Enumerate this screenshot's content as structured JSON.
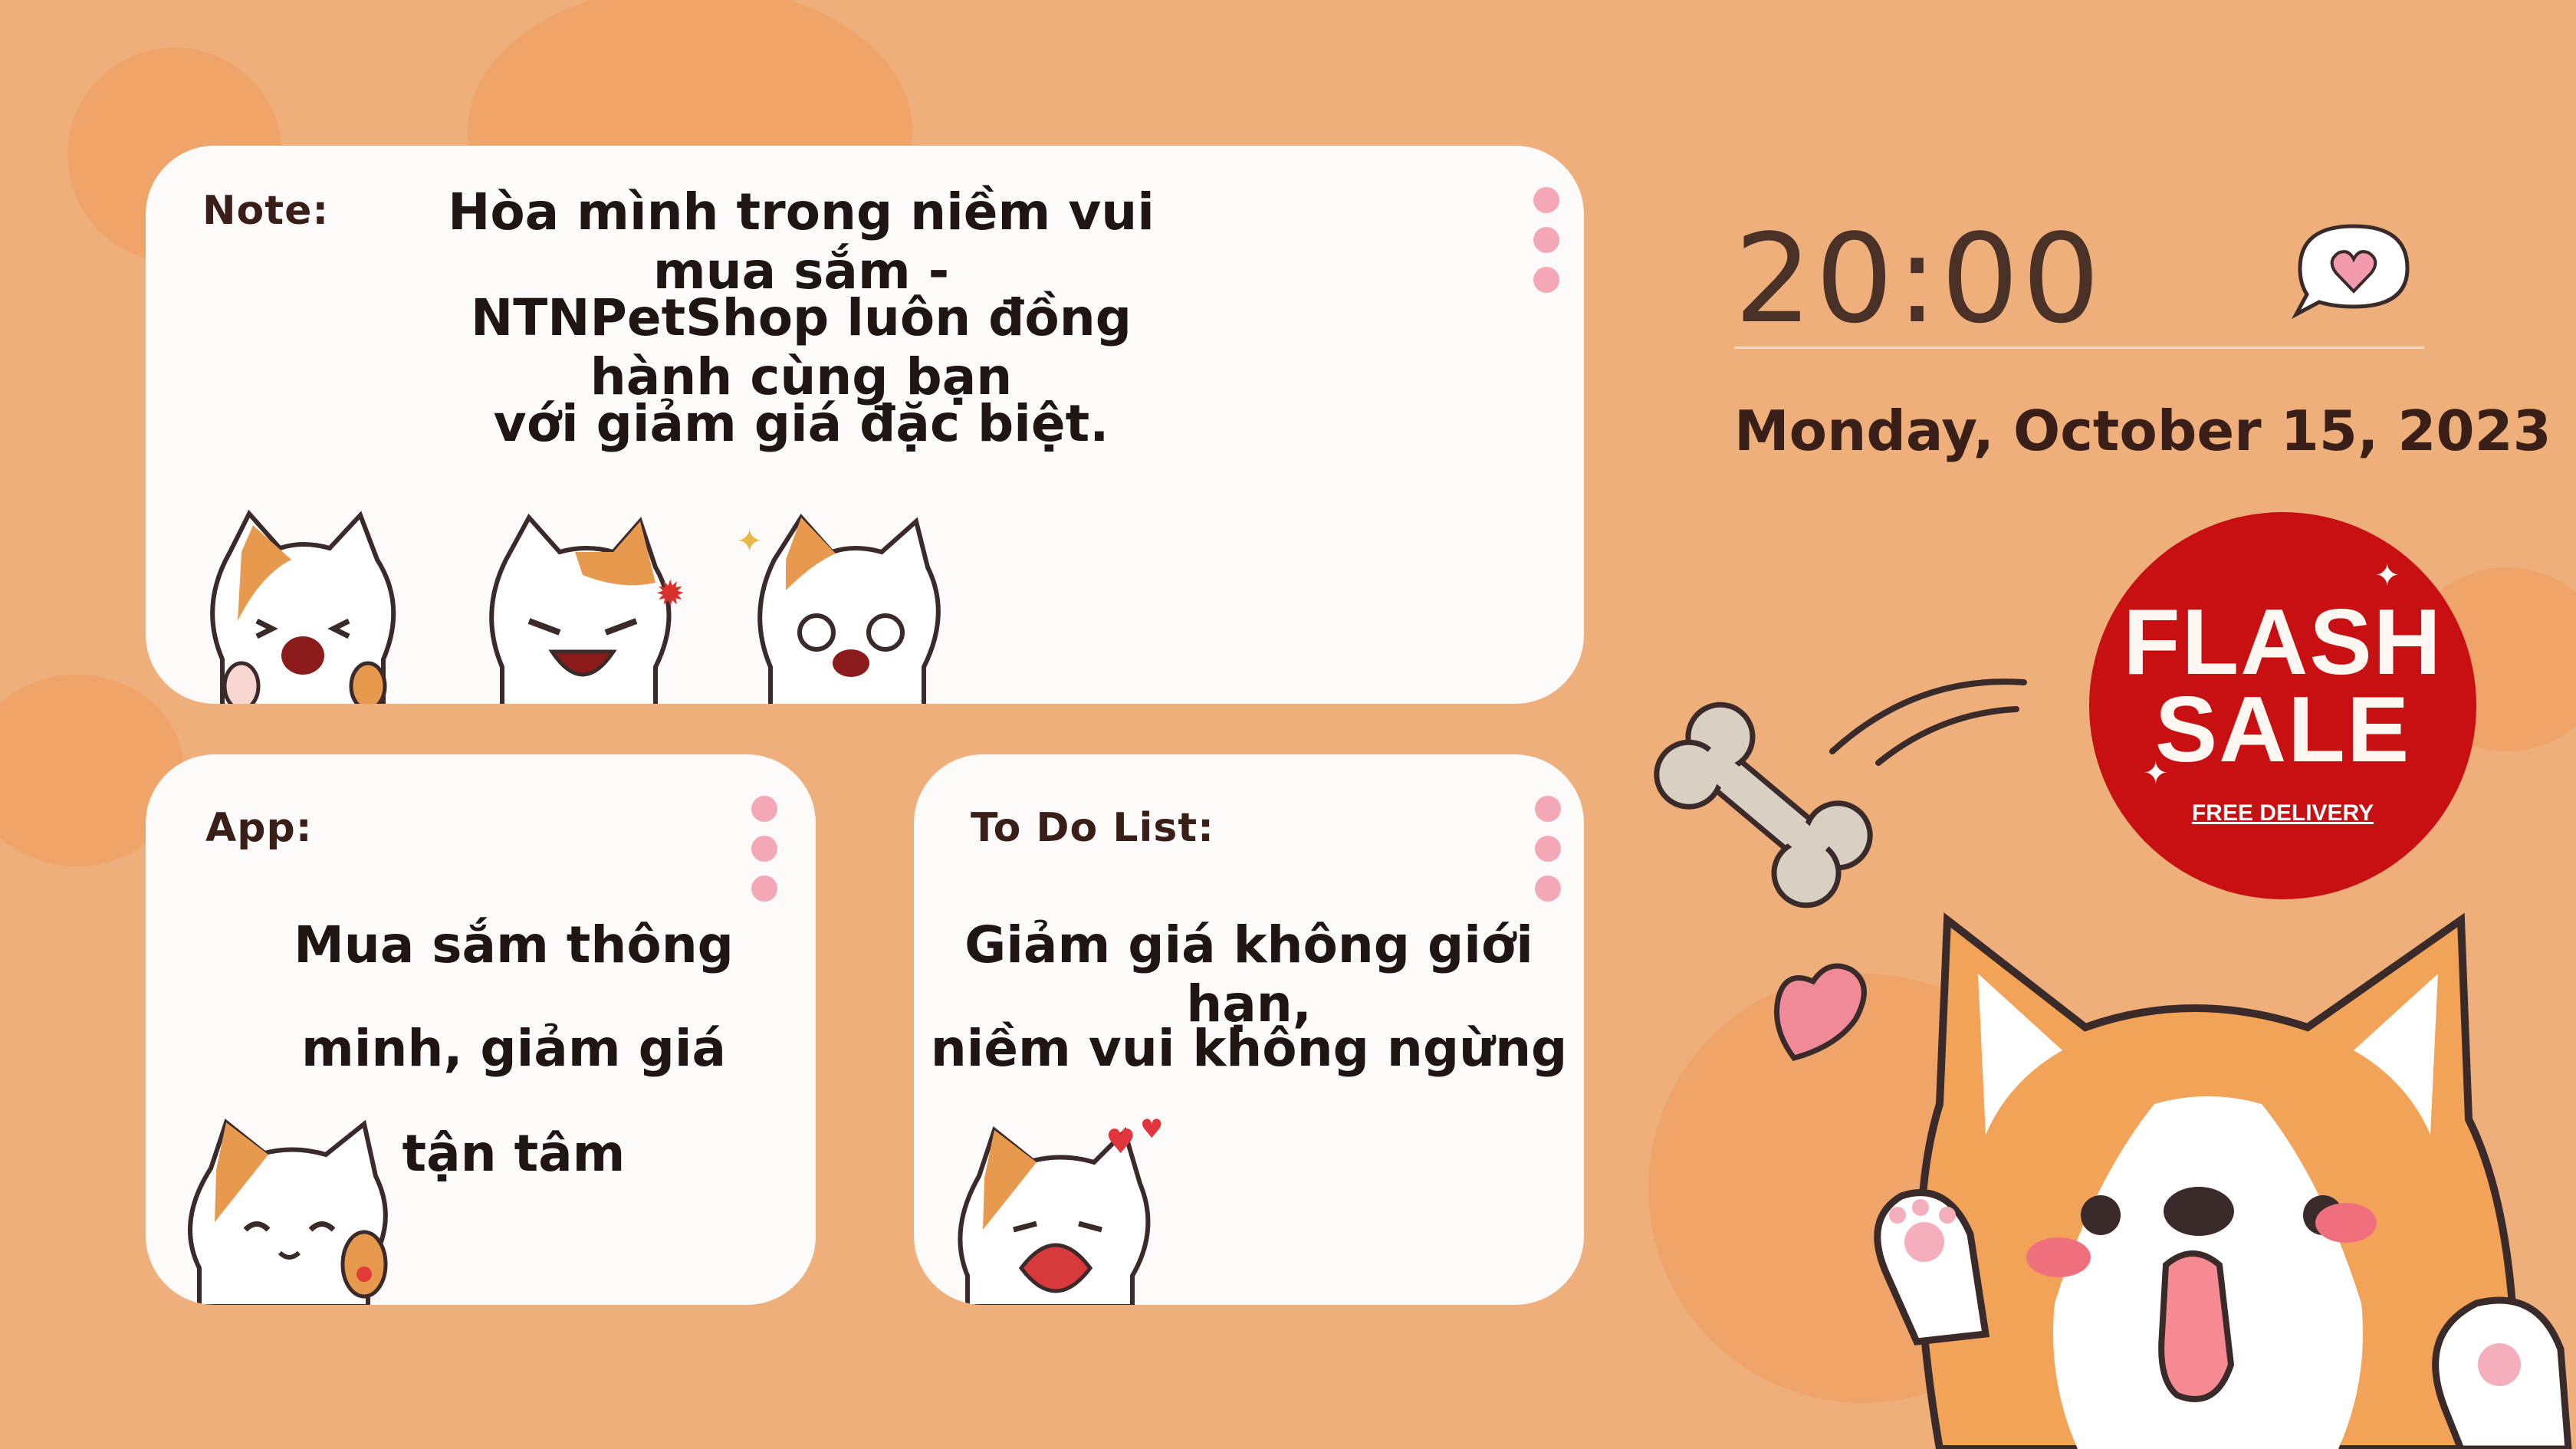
{
  "note": {
    "label": "Note:",
    "lines": [
      "Hòa mình trong niềm vui mua sắm -",
      "NTNPetShop luôn đồng hành cùng bạn",
      "với giảm giá đặc biệt."
    ]
  },
  "app": {
    "label": "App:",
    "lines": [
      "Mua sắm thông",
      "minh, giảm giá",
      "tận tâm"
    ]
  },
  "todo": {
    "label": "To Do List:",
    "lines": [
      "Giảm giá không giới hạn,",
      "niềm vui không ngừng"
    ]
  },
  "clock": {
    "time": "20:00",
    "date": "Monday, October 15, 2023"
  },
  "flash_sale": {
    "title_line1": "FLASH",
    "title_line2": "SALE",
    "subtitle": "FREE DELIVERY"
  },
  "icons": [
    "heart-speech-bubble-icon",
    "bone-icon",
    "heart-icon",
    "sparkle-icon",
    "cat-sticker",
    "corgi-illustration"
  ],
  "colors": {
    "background": "#eeaf7b",
    "card": "#fdfbfa",
    "accent_dot": "#f4a8b5",
    "flash_red": "#c80f12"
  }
}
